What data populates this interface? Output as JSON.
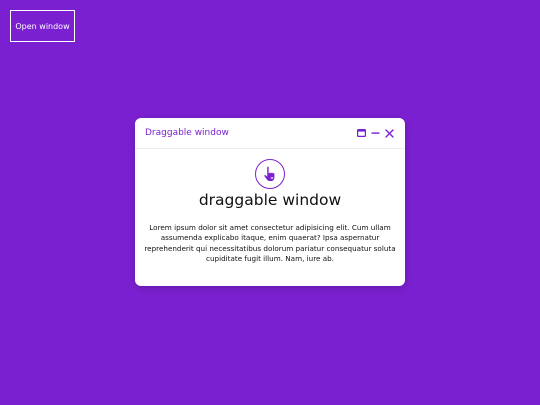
{
  "open_button": {
    "label": "Open window"
  },
  "window": {
    "title": "Draggable window",
    "heading": "draggable window",
    "description": "Lorem ipsum dolor sit amet consectetur adipisicing elit. Cum ullam assumenda explicabo itaque, enim quaerat? Ipsa aspernatur reprehenderit qui necessitatibus dolorum pariatur consequatur soluta cupiditate fugit illum. Nam, iure ab.",
    "controls": [
      "maximize-icon",
      "minimize-icon",
      "close-icon"
    ],
    "hero_icon": "drag-hand-icon"
  },
  "colors": {
    "background": "#7b20d0",
    "accent": "#7b20d0",
    "window_bg": "#ffffff",
    "text": "#111111"
  }
}
